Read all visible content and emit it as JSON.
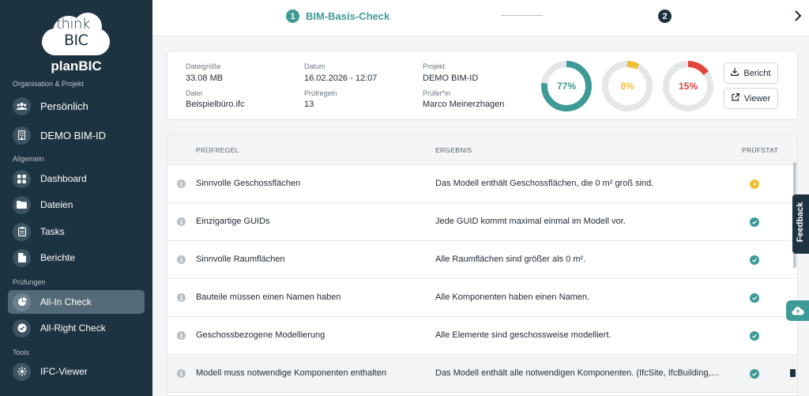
{
  "brand": {
    "logo_line1": "think",
    "logo_line2": "BIC",
    "app_name": "planBIC"
  },
  "sidebar": {
    "sections": {
      "org": "Organisation & Projekt",
      "allgemein": "Allgemein",
      "pruefungen": "Prüfungen",
      "tools": "Tools"
    },
    "items": [
      {
        "label": "Persönlich",
        "icon": "users-icon"
      },
      {
        "label": "DEMO BIM-ID",
        "icon": "building-icon"
      },
      {
        "label": "Dashboard",
        "icon": "grid-icon"
      },
      {
        "label": "Dateien",
        "icon": "folder-icon"
      },
      {
        "label": "Tasks",
        "icon": "clipboard-icon"
      },
      {
        "label": "Berichte",
        "icon": "report-icon"
      },
      {
        "label": "All-In Check",
        "icon": "pie-icon",
        "active": true
      },
      {
        "label": "All-Right Check",
        "icon": "check-circle-icon"
      },
      {
        "label": "IFC-Viewer",
        "icon": "viewer-icon"
      }
    ]
  },
  "stepper": {
    "step1_num": "1",
    "step1_label": "BIM-Basis-Check",
    "step2_num": "2"
  },
  "info": {
    "dateigroesse_label": "Dateigröße",
    "dateigroesse": "33.08 MB",
    "datei_label": "Datei",
    "datei": "Beispielbüro.ifc",
    "datum_label": "Datum",
    "datum": "16.02.2026 - 12:07",
    "pruefregeln_label": "Prüfregeln",
    "pruefregeln": "13",
    "projekt_label": "Projekt",
    "projekt": "DEMO BIM-ID",
    "pruefer_label": "Prüfer*in",
    "pruefer": "Marco Meinerzhagen"
  },
  "donuts": [
    {
      "label": "77%",
      "value": 77,
      "color": "#3e9a96"
    },
    {
      "label": "8%",
      "value": 8,
      "color": "#f0bf3a"
    },
    {
      "label": "15%",
      "value": 15,
      "color": "#e0473c"
    }
  ],
  "buttons": {
    "bericht": "Bericht",
    "viewer": "Viewer"
  },
  "table": {
    "headers": {
      "rule": "PRÜFREGEL",
      "result": "ERGEBNIS",
      "status": "PRÜFSTAT"
    },
    "rows": [
      {
        "rule": "Sinnvolle Geschossflächen",
        "result": "Das Modell enthält Geschossflächen, die 0 m² groß sind.",
        "status": "warn"
      },
      {
        "rule": "Einzigartige GUIDs",
        "result": "Jede GUID kommt maximal einmal im Modell vor.",
        "status": "ok"
      },
      {
        "rule": "Sinnvolle Raumflächen",
        "result": "Alle Raumflächen sind größer als 0 m².",
        "status": "ok"
      },
      {
        "rule": "Bauteile müssen einen Namen haben",
        "result": "Alle Komponenten haben einen Namen.",
        "status": "ok"
      },
      {
        "rule": "Geschossbezogene Modellierung",
        "result": "Alle Elemente sind geschossweise modelliert.",
        "status": "ok"
      },
      {
        "rule": "Modell muss notwendige Komponenten enthalten",
        "result": "Das Modell enthält alle notwendigen Komponenten. (IfcSite, IfcBuilding, Ifc...",
        "status": "ok"
      }
    ]
  },
  "feedback": "Feedback",
  "info_glyph": "i"
}
